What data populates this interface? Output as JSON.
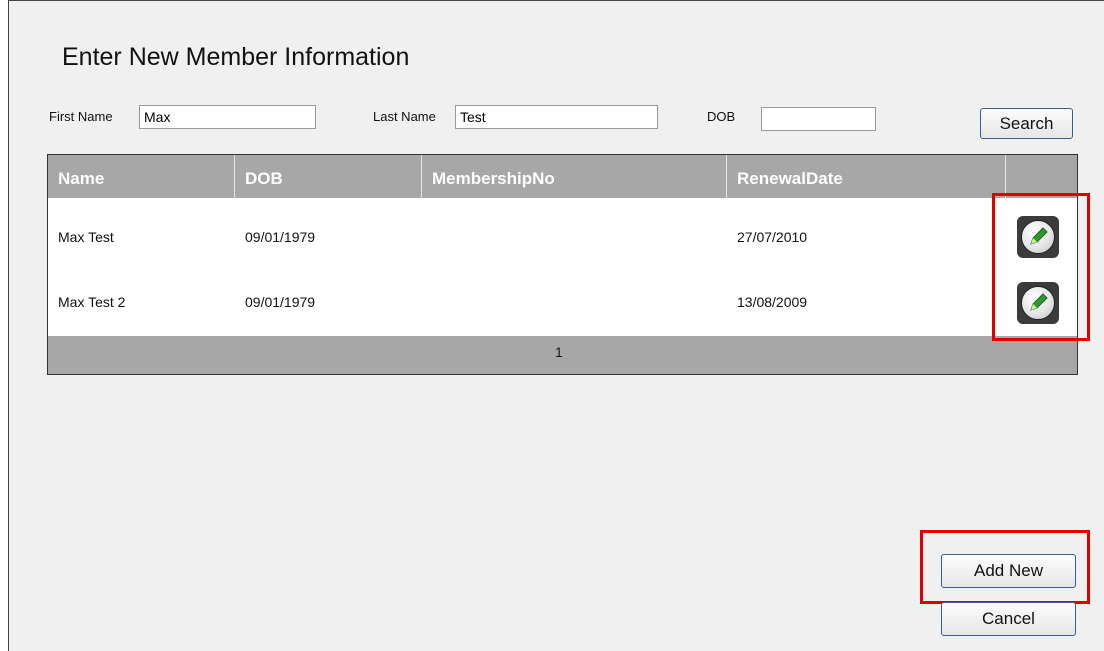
{
  "form": {
    "title": "Enter New Member Information",
    "first_name_label": "First Name",
    "first_name_value": "Max",
    "last_name_label": "Last Name",
    "last_name_value": "Test",
    "dob_label": "DOB",
    "dob_value": "",
    "search_label": "Search"
  },
  "grid": {
    "columns": [
      "Name",
      "DOB",
      "MembershipNo",
      "RenewalDate",
      ""
    ],
    "rows": [
      {
        "name": "Max Test",
        "dob": "09/01/1979",
        "membership_no": "",
        "renewal_date": "27/07/2010",
        "action_icon": "edit-pencil-icon"
      },
      {
        "name": "Max Test 2",
        "dob": "09/01/1979",
        "membership_no": "",
        "renewal_date": "13/08/2009",
        "action_icon": "edit-pencil-icon"
      }
    ],
    "pager": "1",
    "header_color": "#a7a7a7"
  },
  "actions": {
    "add_new_label": "Add New",
    "cancel_label": "Cancel"
  },
  "highlight_color": "#e00000"
}
